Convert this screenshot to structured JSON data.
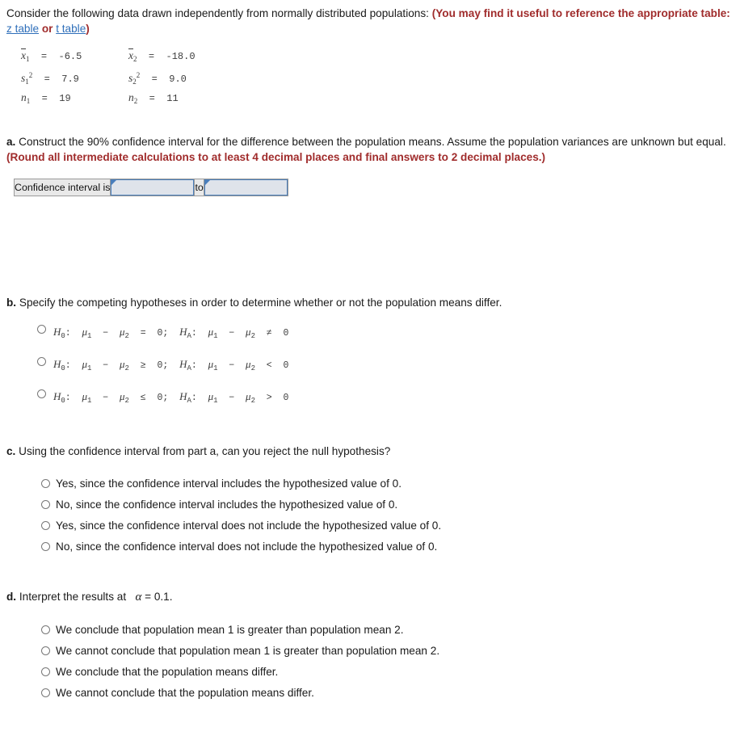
{
  "intro": {
    "text_plain": "Consider the following data drawn independently from normally distributed populations:",
    "text_red_1": "(You may find it useful to reference the appropriate table:",
    "link_z": "z table",
    "text_red_or": "or",
    "link_t": "t table",
    "text_red_close": ")"
  },
  "given_data": {
    "rows": [
      {
        "left_var": "x",
        "left_sub": "1",
        "left_val": "=  -6.5",
        "right_var": "x",
        "right_sub": "2",
        "right_val": "=  -18.0"
      },
      {
        "left_var": "s",
        "left_sub": "1",
        "left_sup": "2",
        "left_val": "=  7.9",
        "right_var": "s",
        "right_sub": "2",
        "right_sup": "2",
        "right_val": "=  9.0"
      },
      {
        "left_var": "n",
        "left_sub": "1",
        "left_val": "=  19",
        "right_var": "n",
        "right_sub": "2",
        "right_val": "=  11"
      }
    ],
    "x1_bar": "-6.5",
    "x2_bar": "-18.0",
    "s1_squared": "7.9",
    "s2_squared": "9.0",
    "n1": "19",
    "n2": "11",
    "confidence_level": "90%",
    "alpha": "0.1"
  },
  "part_a": {
    "label": "a.",
    "text": "Construct the 90% confidence interval for the difference between the population means. Assume the population variances are unknown but equal.",
    "note_red": "(Round all intermediate calculations to at least 4 decimal places and final answers to 2 decimal places.)",
    "answer": {
      "label": "Confidence interval is",
      "lower_value": "",
      "lower_placeholder": "",
      "separator": "to",
      "upper_value": "",
      "upper_placeholder": ""
    }
  },
  "part_b": {
    "label": "b.",
    "text": "Specify the competing hypotheses in order to determine whether or not the population means differ.",
    "options": [
      {
        "h0_mu1": "μ",
        "h0_sub1": "1",
        "h0_minus": "−",
        "h0_mu2": "μ",
        "h0_sub2": "2",
        "h0_rel": "=",
        "h0_val": "0",
        "ha_rel": "≠",
        "ha_val": "0",
        "full_text": "H0: μ1 − μ2 = 0; HA: μ1 − μ2 ≠ 0"
      },
      {
        "h0_rel": "≥",
        "h0_val": "0",
        "ha_rel": "<",
        "ha_val": "0",
        "full_text": "H0: μ1 − μ2 ≥ 0; HA: μ1 − μ2 < 0"
      },
      {
        "h0_rel": "≤",
        "h0_val": "0",
        "ha_rel": ">",
        "ha_val": "0",
        "full_text": "H0: μ1 − μ2 ≤ 0; HA: μ1 − μ2 > 0"
      }
    ]
  },
  "part_c": {
    "label": "c.",
    "text": "Using the confidence interval from part a, can you reject the null hypothesis?",
    "options": [
      "Yes, since the confidence interval includes the hypothesized value of 0.",
      "No, since the confidence interval includes the hypothesized value of 0.",
      "Yes, since the confidence interval does not include the hypothesized value of 0.",
      "No, since the confidence interval does not include the hypothesized value of 0."
    ]
  },
  "part_d": {
    "label": "d.",
    "text_before": "Interpret the results at",
    "alpha_symbol": "α",
    "text_after": "= 0.1.",
    "options": [
      "We conclude that population mean 1 is greater than population mean 2.",
      "We cannot conclude that population mean 1 is greater than population mean 2.",
      "We conclude that the population means differ.",
      "We cannot conclude that the population means differ."
    ]
  },
  "colors": {
    "red_emphasis": "#a02c2c",
    "link_blue": "#2f6fba",
    "input_border": "#4a7ebb",
    "input_fill": "#dfe3ea",
    "cell_fill": "#e9e9e9",
    "text": "#1a1a1a"
  }
}
